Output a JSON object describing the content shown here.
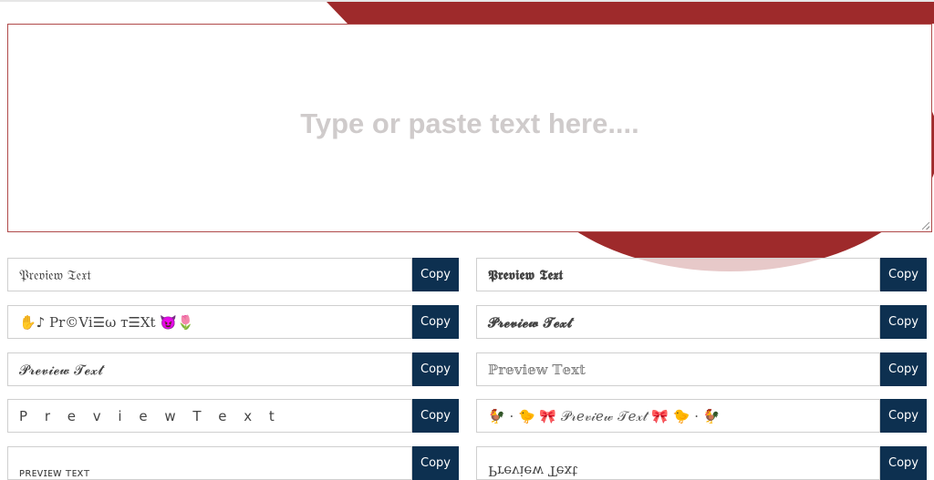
{
  "textarea": {
    "placeholder": "Type or paste text here...."
  },
  "colors": {
    "accent_red": "#9e2a2b",
    "button_bg": "#0d3050"
  },
  "results": {
    "left": [
      {
        "text": "𝔓𝔯𝔢𝔳𝔦𝔢𝔴 𝔗𝔢𝔵𝔱",
        "copy": "Copy"
      },
      {
        "text": "✋♪ Pr©Vi☰ω т☰Xt 😈🌷",
        "copy": "Copy"
      },
      {
        "text": "𝓟𝓻𝓮𝓿𝓲𝓮𝔀 𝓣𝓮𝔁𝓽",
        "copy": "Copy"
      },
      {
        "text": "P r e v i e w T e x t",
        "copy": "Copy"
      },
      {
        "text": "ᴘʀᴇᴠɪᴇᴡ ᴛᴇxᴛ",
        "copy": "Copy"
      }
    ],
    "right": [
      {
        "text": "𝕻𝖗𝖊𝖛𝖎𝖊𝖜 𝕿𝖊𝖝𝖙",
        "copy": "Copy"
      },
      {
        "text": "𝓟𝓻𝓮𝓿𝓲𝓮𝔀 𝓣𝓮𝔁𝓽",
        "copy": "Copy"
      },
      {
        "text": "ℙ𝕣𝕖𝕧𝕚𝕖𝕨 𝕋𝕖𝕩𝕥",
        "copy": "Copy"
      },
      {
        "text": "🐓 · 🐤 🎀 𝒫𝓇𝑒𝓋𝒾𝑒𝓌 𝒯𝑒𝓍𝓉 🎀 🐤 · 🐓",
        "copy": "Copy"
      },
      {
        "text": "Preview Text",
        "copy": "Copy"
      }
    ]
  }
}
